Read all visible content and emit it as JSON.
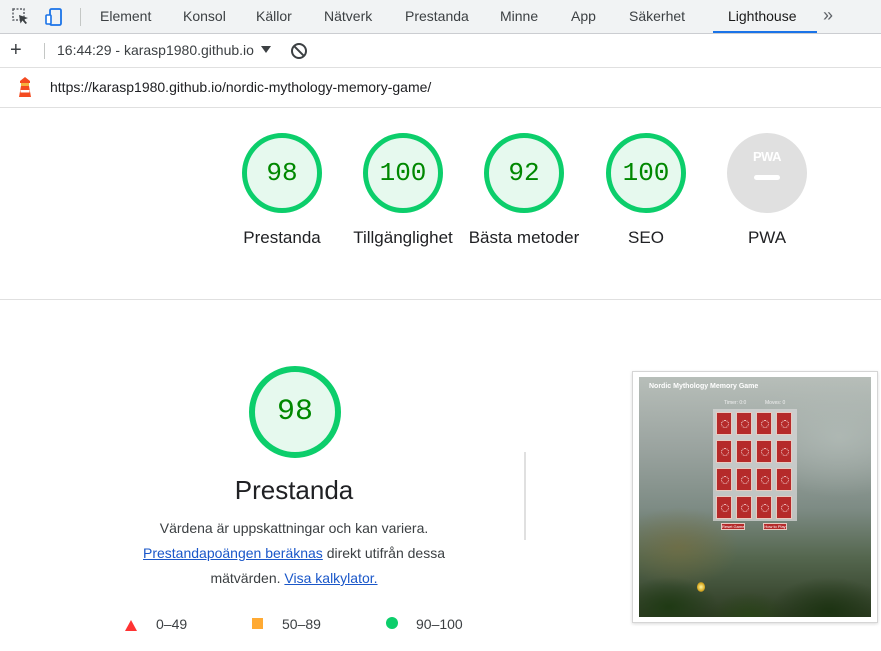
{
  "devtools": {
    "tabs": [
      "Element",
      "Konsol",
      "Källor",
      "Nätverk",
      "Prestanda",
      "Minne",
      "App",
      "Säkerhet",
      "Lighthouse"
    ],
    "active_tab": "Lighthouse",
    "more_tabs_icon": "chevron-double-right-icon"
  },
  "toolbar": {
    "report_select": "16:44:29 - karasp1980.github.io",
    "add_icon": "plus-icon",
    "clear_icon": "block-icon"
  },
  "report": {
    "url": "https://karasp1980.github.io/nordic-mythology-memory-game/"
  },
  "scores": [
    {
      "value": "98",
      "label": "Prestanda"
    },
    {
      "value": "100",
      "label": "Tillgänglighet"
    },
    {
      "value": "92",
      "label": "Bästa metoder"
    },
    {
      "value": "100",
      "label": "SEO"
    },
    {
      "value": "",
      "label": "PWA",
      "badge": "PWA"
    }
  ],
  "performance": {
    "score": "98",
    "title": "Prestanda",
    "desc_line1": "Värdena är uppskattningar och kan variera.",
    "desc_link1": "Prestandapoängen beräknas",
    "desc_mid": " direkt utifrån dessa mätvärden. ",
    "desc_link2": "Visa kalkylator.",
    "legend": [
      "0–49",
      "50–89",
      "90–100"
    ]
  },
  "screenshot": {
    "title": "Nordic Mythology Memory Game",
    "timer": "Timer: 0:0",
    "moves": "Moves: 0",
    "buttons": [
      "Reset Game",
      "How to Play"
    ]
  },
  "colors": {
    "pass": "#0cce6b",
    "average": "#ffaa33",
    "fail": "#ff3333",
    "accent": "#1a73e8"
  }
}
